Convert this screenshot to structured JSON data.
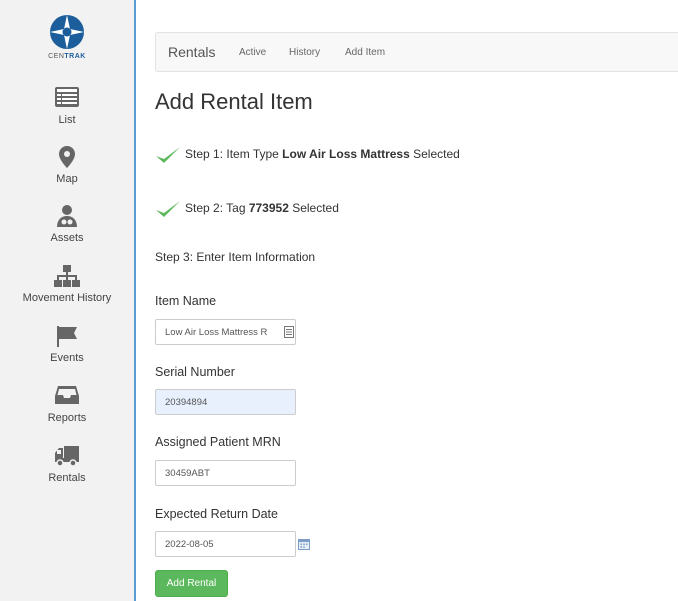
{
  "sidebar": {
    "logo_text_prefix": "CEN",
    "logo_text_bold": "TRAK",
    "items": [
      {
        "label": "List",
        "icon": "list-icon"
      },
      {
        "label": "Map",
        "icon": "map-pin-icon"
      },
      {
        "label": "Assets",
        "icon": "assets-icon"
      },
      {
        "label": "Movement History",
        "icon": "movement-history-icon"
      },
      {
        "label": "Events",
        "icon": "flag-icon"
      },
      {
        "label": "Reports",
        "icon": "inbox-icon"
      },
      {
        "label": "Rentals",
        "icon": "truck-icon"
      }
    ]
  },
  "navbar": {
    "brand": "Rentals",
    "links": [
      "Active",
      "History",
      "Add Item"
    ]
  },
  "page": {
    "title": "Add Rental Item",
    "step1": {
      "prefix": "Step 1: Item Type ",
      "value": "Low Air Loss Mattress",
      "suffix": " Selected"
    },
    "step2": {
      "prefix": "Step 2: Tag ",
      "value": "773952",
      "suffix": " Selected"
    },
    "step3": "Step 3: Enter Item Information"
  },
  "form": {
    "item_name": {
      "label": "Item Name",
      "value": "Low Air Loss Mattress R"
    },
    "serial_number": {
      "label": "Serial Number",
      "value": "20394894"
    },
    "patient_mrn": {
      "label": "Assigned Patient MRN",
      "value": "30459ABT"
    },
    "return_date": {
      "label": "Expected Return Date",
      "value": "2022-08-05"
    },
    "submit_label": "Add Rental"
  },
  "colors": {
    "accent": "#1b5e9b",
    "sidebar_border": "#5b9bd5",
    "check": "#5cb85c",
    "button": "#5cb85c"
  }
}
